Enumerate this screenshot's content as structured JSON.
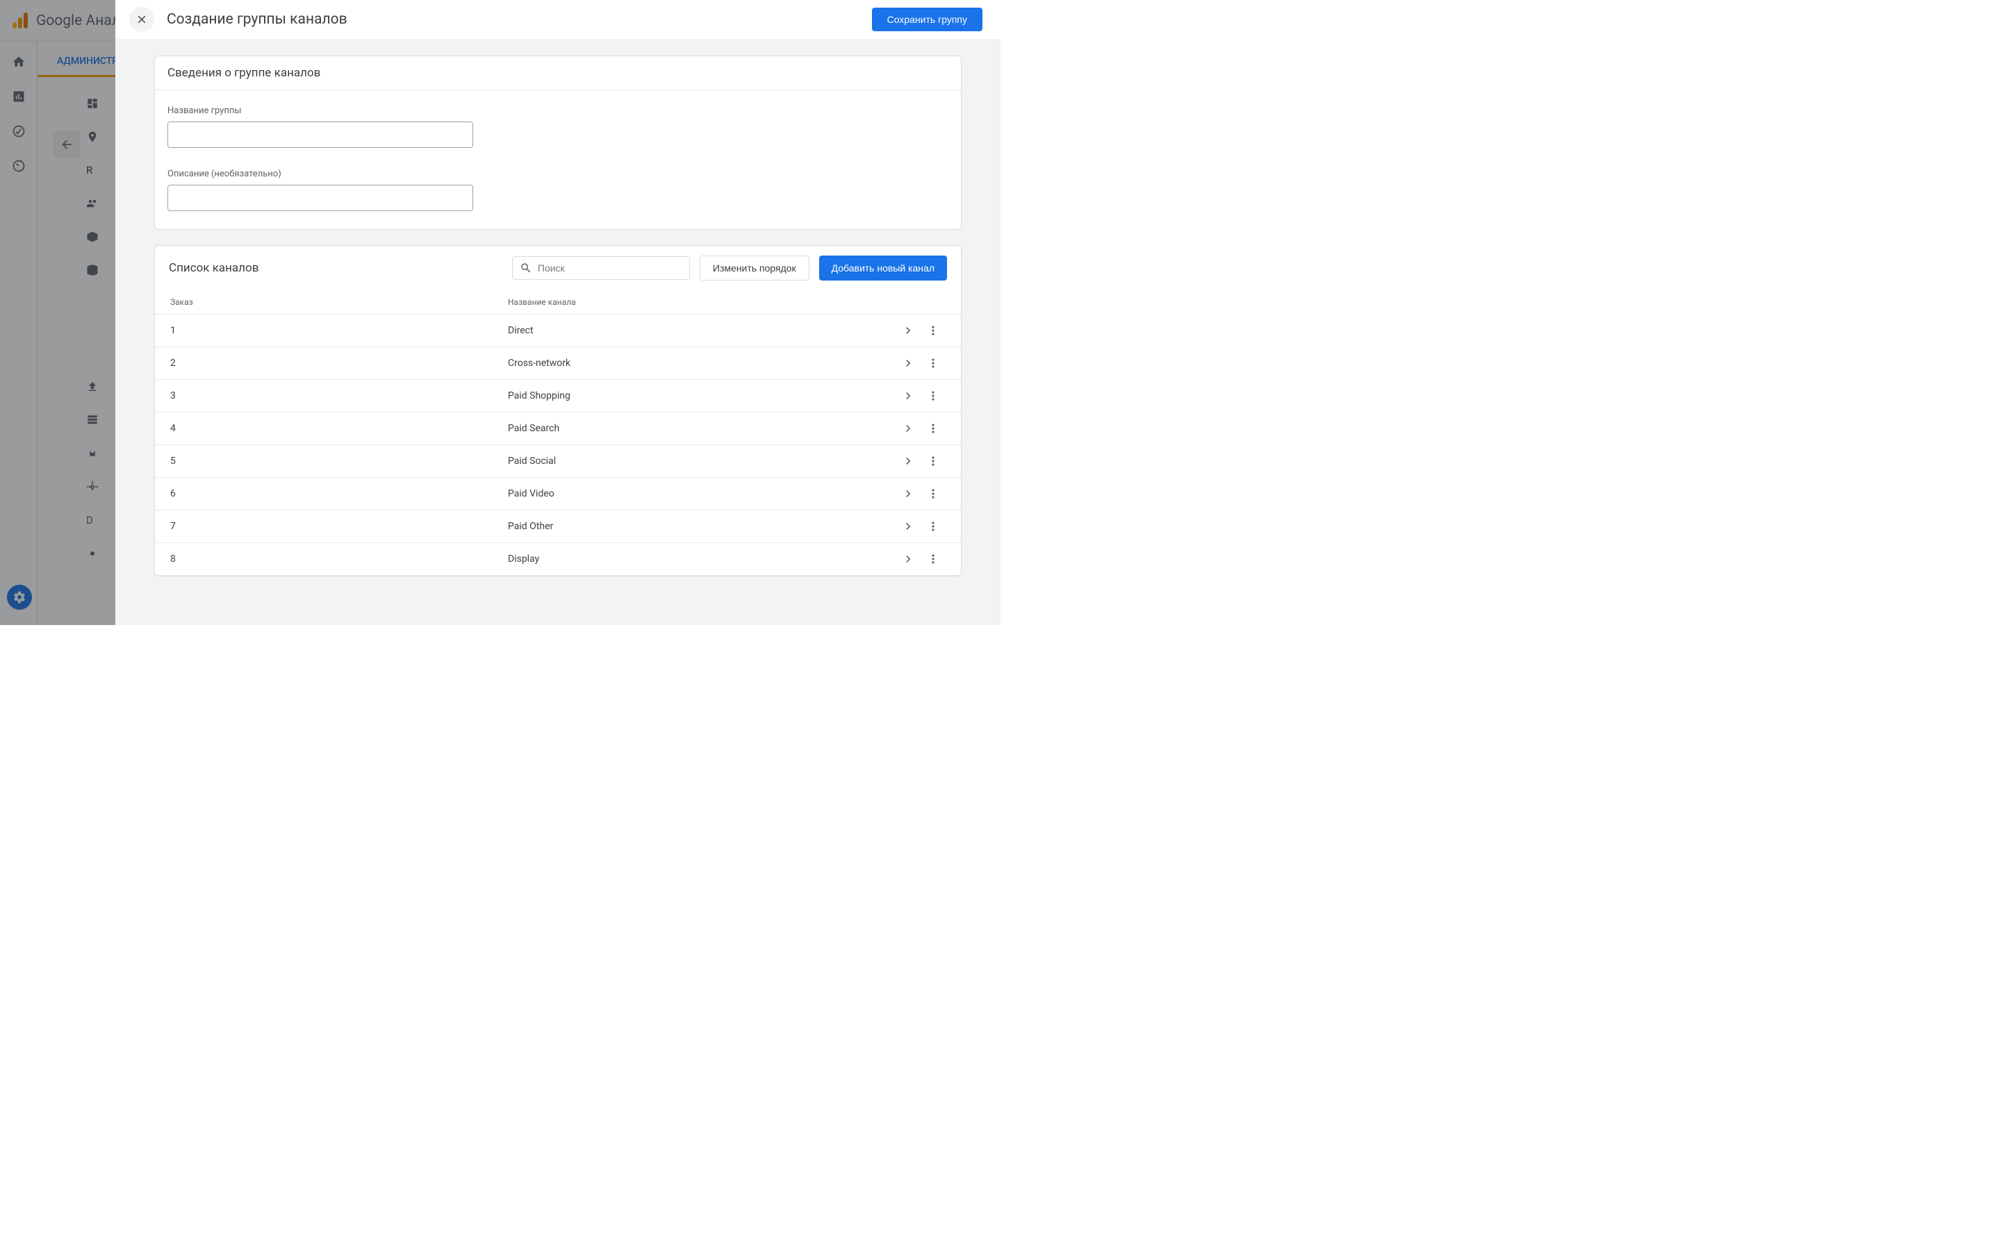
{
  "background": {
    "app_name": "Google Аналитика",
    "tab_label": "АДМИНИСТРИРОВАНИЕ"
  },
  "modal": {
    "title": "Создание группы каналов",
    "save_label": "Сохранить группу",
    "section_details": {
      "heading": "Сведения о группе каналов",
      "name_label": "Название группы",
      "name_value": "",
      "desc_label": "Описание (необязательно)",
      "desc_value": ""
    },
    "section_list": {
      "heading": "Список каналов",
      "search_placeholder": "Поиск",
      "reorder_label": "Изменить порядок",
      "add_label": "Добавить новый канал",
      "col_order": "Заказ",
      "col_name": "Название канала",
      "channels": [
        {
          "order": "1",
          "name": "Direct"
        },
        {
          "order": "2",
          "name": "Cross-network"
        },
        {
          "order": "3",
          "name": "Paid Shopping"
        },
        {
          "order": "4",
          "name": "Paid Search"
        },
        {
          "order": "5",
          "name": "Paid Social"
        },
        {
          "order": "6",
          "name": "Paid Video"
        },
        {
          "order": "7",
          "name": "Paid Other"
        },
        {
          "order": "8",
          "name": "Display"
        }
      ]
    }
  }
}
